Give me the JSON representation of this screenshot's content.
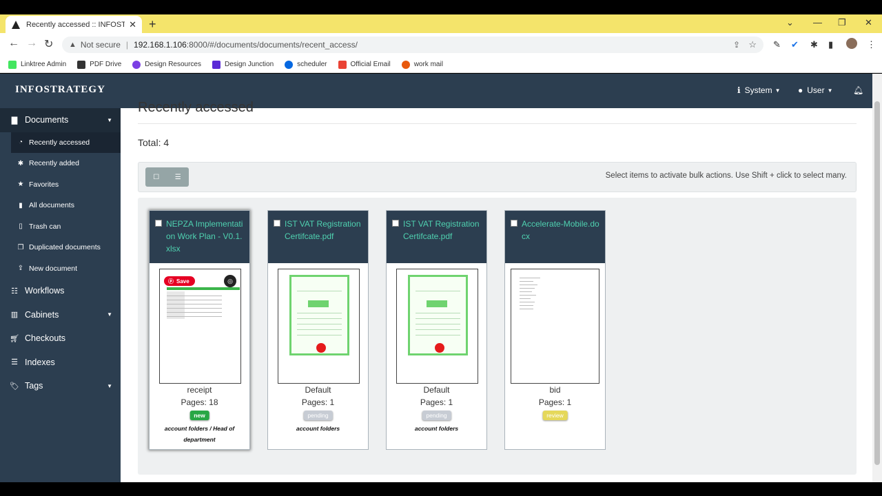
{
  "browser": {
    "tab_title": "Recently accessed :: INFOSTRATE",
    "url_security": "Not secure",
    "url_host": "192.168.1.106",
    "url_port_path": ":8000/#/documents/documents/recent_access/",
    "bookmarks": [
      {
        "label": "Linktree Admin",
        "color": "#43e660"
      },
      {
        "label": "PDF Drive",
        "color": "#333333"
      },
      {
        "label": "Design Resources",
        "color": "#7b3fe4"
      },
      {
        "label": "Design Junction",
        "color": "#5b2bd6"
      },
      {
        "label": "scheduler",
        "color": "#0668e1"
      },
      {
        "label": "Official Email",
        "color": "#ea4335"
      },
      {
        "label": "work mail",
        "color": "#e8590c"
      }
    ]
  },
  "header": {
    "brand": "INFOSTRATEGY",
    "system_label": "System",
    "user_label": "User"
  },
  "sidebar": {
    "documents": "Documents",
    "sub": [
      "Recently accessed",
      "Recently added",
      "Favorites",
      "All documents",
      "Trash can",
      "Duplicated documents",
      "New document"
    ],
    "workflows": "Workflows",
    "cabinets": "Cabinets",
    "checkouts": "Checkouts",
    "indexes": "Indexes",
    "tags": "Tags"
  },
  "main": {
    "title": "Recently accessed",
    "total": "Total: 4",
    "bulk_message": "Select items to activate bulk actions. Use Shift + click to select many."
  },
  "cards": [
    {
      "name": "NEPZA Implementation Work Plan - V0.1.xlsx",
      "type": "receipt",
      "pages": "Pages: 18",
      "tag": "new",
      "folder": "account folders / Head of department",
      "pin_label": "Save"
    },
    {
      "name": "IST VAT Registration Certifcate.pdf",
      "type": "Default",
      "pages": "Pages: 1",
      "tag": "pending",
      "folder": "account folders"
    },
    {
      "name": "IST VAT Registration Certifcate.pdf",
      "type": "Default",
      "pages": "Pages: 1",
      "tag": "pending",
      "folder": "account folders"
    },
    {
      "name": "Accelerate-Mobile.docx",
      "type": "bid",
      "pages": "Pages: 1",
      "tag": "review",
      "folder": ""
    }
  ],
  "colors": {
    "header_bg": "#2c3e50",
    "link_teal": "#4fd1b0",
    "tag_new": "#28a745",
    "tag_pending": "#c7ccd4",
    "tag_review": "#e5d85a"
  }
}
